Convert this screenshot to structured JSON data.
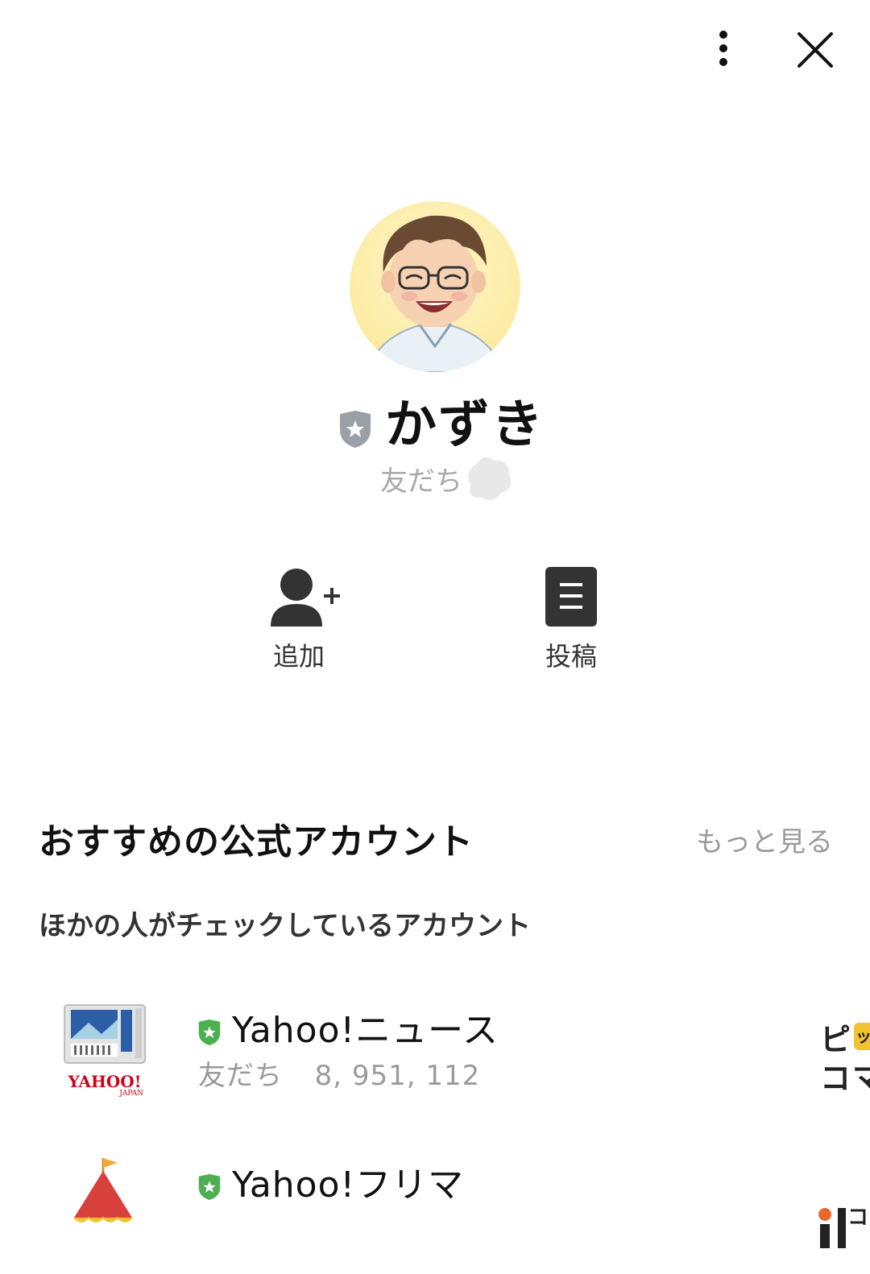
{
  "header": {
    "menu_icon": "vertical-dots-icon",
    "close_icon": "close-icon"
  },
  "profile": {
    "name": "かずき",
    "status_tag": "友だち",
    "badge_icon": "grey-shield-star-icon"
  },
  "actions": [
    {
      "label": "追加",
      "icon": "add-friend-icon"
    },
    {
      "label": "投稿",
      "icon": "post-document-icon"
    }
  ],
  "recommend": {
    "title": "おすすめの公式アカウント",
    "more_label": "もっと見る",
    "subtitle": "ほかの人がチェックしているアカウント",
    "accounts": [
      {
        "name": "Yahoo!ニュース",
        "count_label": "友だち",
        "count": "8, 951, 112",
        "logo_text": "YAHOO!",
        "logo_subtext": "JAPAN",
        "badge_color": "#4caf50"
      },
      {
        "name": "Yahoo!フリマ",
        "badge_color": "#4caf50"
      }
    ]
  },
  "colors": {
    "accent_green": "#4caf50",
    "icon_dark": "#333333",
    "muted_text": "#9a9a9a"
  }
}
